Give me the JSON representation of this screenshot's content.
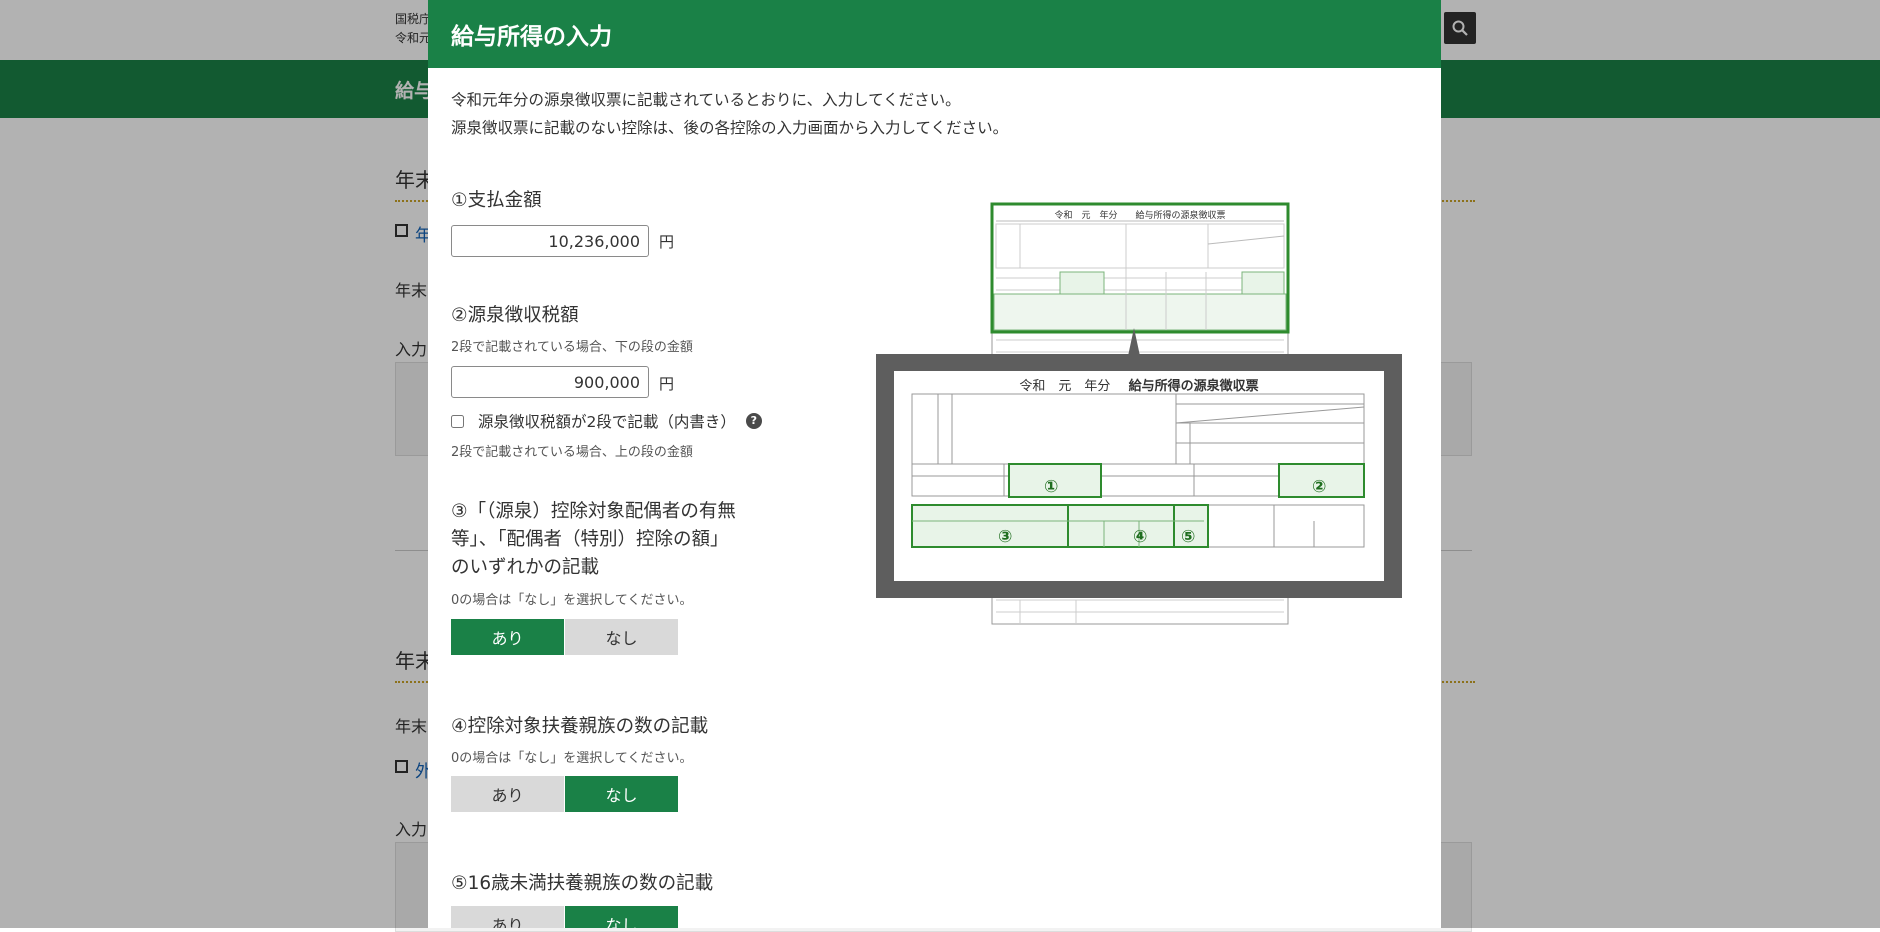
{
  "background": {
    "header_line1": "国税庁",
    "header_line2": "令和元",
    "greenbar_title": "給与",
    "section1_title": "年末",
    "section1_link": "年",
    "section1_text": "年末",
    "section1_input_label": "入力",
    "section2_title": "年末",
    "section2_text": "年末",
    "section2_link": "外",
    "section2_input_label": "入力"
  },
  "modal": {
    "title": "給与所得の入力",
    "intro_line1": "令和元年分の源泉徴収票に記載されているとおりに、入力してください。",
    "intro_line2": "源泉徴収票に記載のない控除は、後の各控除の入力画面から入力してください。",
    "unit": "円",
    "payment": {
      "label": "①支払金額",
      "value": "10,236,000"
    },
    "withholding": {
      "label": "②源泉徴収税額",
      "note_lower": "2段で記載されている場合、下の段の金額",
      "value": "900,000",
      "checkbox_label": "源泉徴収税額が2段で記載（内書き）",
      "help_glyph": "?",
      "note_upper": "2段で記載されている場合、上の段の金額"
    },
    "spouse": {
      "label_line1": "③「（源泉）控除対象配偶者の有無",
      "label_line2": "等」、「配偶者（特別）控除の額」",
      "label_line3": "のいずれかの記載",
      "note": "0の場合は「なし」を選択してください。",
      "options": [
        "あり",
        "なし"
      ],
      "selected": "あり"
    },
    "dependents": {
      "label": "④控除対象扶養親族の数の記載",
      "note": "0の場合は「なし」を選択してください。",
      "options": [
        "あり",
        "なし"
      ],
      "selected": "なし"
    },
    "under16": {
      "label": "⑤16歳未満扶養親族の数の記載",
      "options": [
        "あり",
        "なし"
      ],
      "selected": "なし"
    },
    "illustration": {
      "small_title": "令和　元　年分　　給与所得の源泉徴収票",
      "zoom_title_prefix": "令和　元　年分",
      "zoom_title": "給与所得の源泉徴収票",
      "markers": [
        "①",
        "②",
        "③",
        "④",
        "⑤"
      ],
      "accent_color": "#2e8b2e"
    }
  },
  "colors": {
    "brand_green": "#1a8147",
    "toggle_off": "#d9d9d9",
    "overlay": "rgba(0,0,0,0.3)"
  }
}
